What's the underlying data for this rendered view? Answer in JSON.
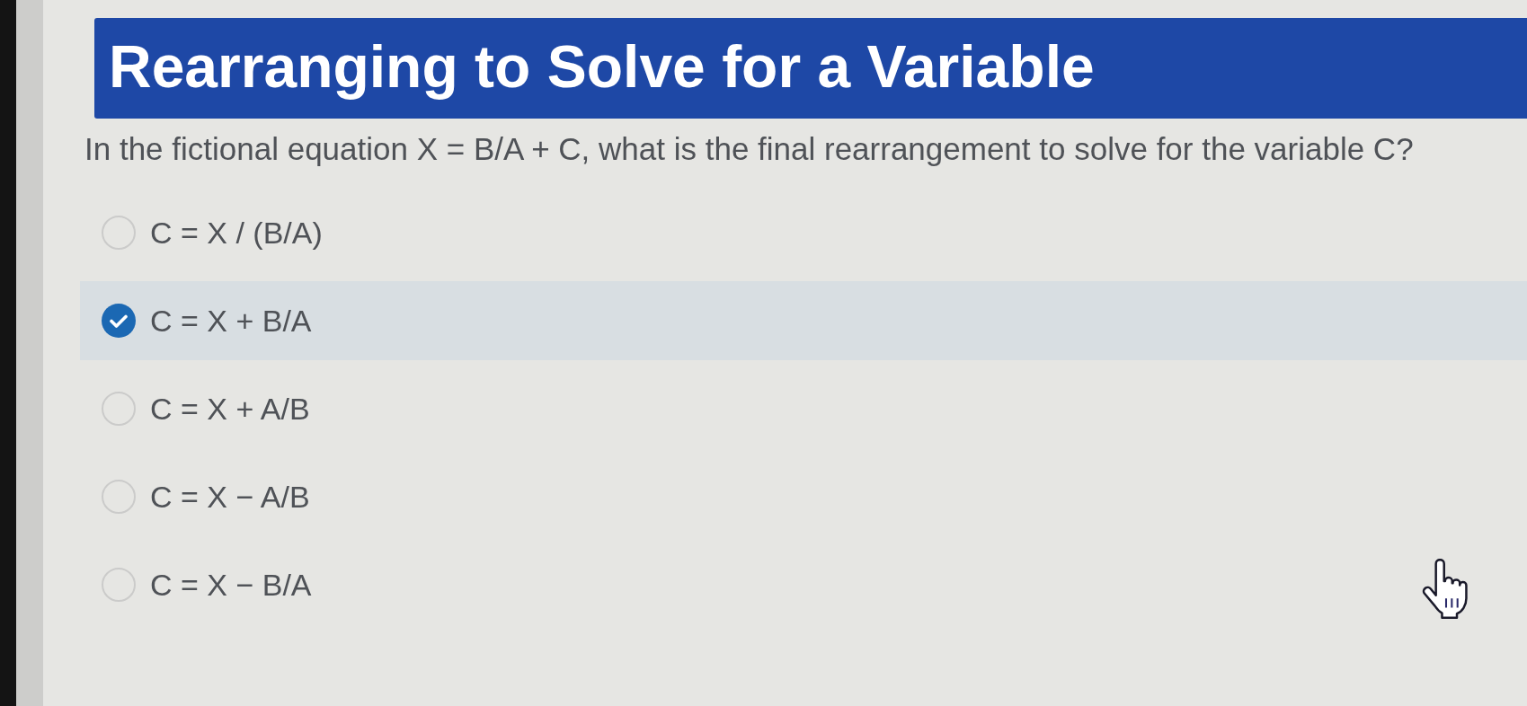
{
  "title": "Rearranging to Solve for a Variable",
  "question": "In the fictional equation X = B/A + C, what is the final rearrangement to solve for the variable C?",
  "options": [
    {
      "label": "C = X / (B/A)",
      "selected": false
    },
    {
      "label": "C = X + B/A",
      "selected": true
    },
    {
      "label": "C = X + A/B",
      "selected": false
    },
    {
      "label": "C = X − A/B",
      "selected": false
    },
    {
      "label": "C = X − B/A",
      "selected": false
    }
  ]
}
